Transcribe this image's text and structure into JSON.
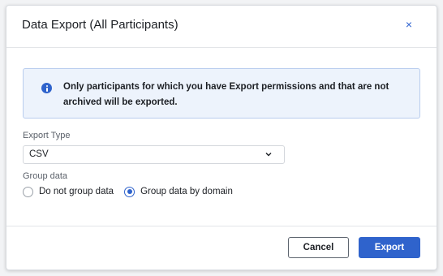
{
  "dialog": {
    "title": "Data Export (All Participants)",
    "close_glyph": "×"
  },
  "alert": {
    "icon": "info-icon",
    "message": "Only participants for which you have Export permissions and that are not archived will be exported."
  },
  "export_type": {
    "label": "Export Type",
    "selected": "CSV",
    "icon": "chevron-down-icon"
  },
  "group_data": {
    "label": "Group data",
    "options": [
      {
        "label": "Do not group data",
        "checked": false
      },
      {
        "label": "Group data by domain",
        "checked": true
      }
    ]
  },
  "footer": {
    "cancel_label": "Cancel",
    "export_label": "Export"
  },
  "colors": {
    "accent": "#2f63cc",
    "alert_background": "#edf3fc",
    "alert_border": "#b9cdee"
  }
}
